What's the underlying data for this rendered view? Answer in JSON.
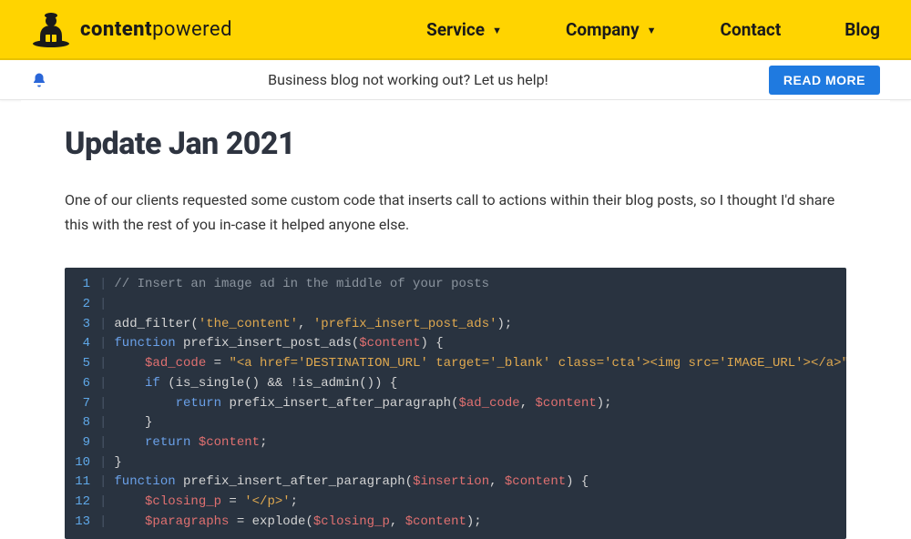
{
  "header": {
    "logo_bold": "content",
    "logo_light": "powered",
    "nav": [
      {
        "label": "Service",
        "dropdown": true
      },
      {
        "label": "Company",
        "dropdown": true
      },
      {
        "label": "Contact",
        "dropdown": false
      },
      {
        "label": "Blog",
        "dropdown": false
      }
    ]
  },
  "subbar": {
    "text": "Business blog not working out? Let us help!",
    "button": "READ MORE"
  },
  "article": {
    "title": "Update Jan 2021",
    "body": "One of our clients requested some custom code that inserts call to actions within their blog posts, so I thought I'd share this with the rest of you in-case it helped anyone else."
  },
  "code": {
    "lines": [
      {
        "n": 1,
        "t": [
          [
            "comment",
            "// Insert an image ad in the middle of your posts"
          ]
        ]
      },
      {
        "n": 2,
        "t": [
          [
            "plain",
            ""
          ]
        ]
      },
      {
        "n": 3,
        "t": [
          [
            "func",
            "add_filter("
          ],
          [
            "str",
            "'the_content'"
          ],
          [
            "func",
            ", "
          ],
          [
            "str",
            "'prefix_insert_post_ads'"
          ],
          [
            "func",
            ");"
          ]
        ]
      },
      {
        "n": 4,
        "t": [
          [
            "key",
            "function"
          ],
          [
            "func",
            " prefix_insert_post_ads("
          ],
          [
            "var",
            "$content"
          ],
          [
            "func",
            ") {"
          ]
        ]
      },
      {
        "n": 5,
        "t": [
          [
            "plain",
            "    "
          ],
          [
            "var",
            "$ad_code"
          ],
          [
            "func",
            " = "
          ],
          [
            "str",
            "\"<a href='DESTINATION_URL' target='_blank' class='cta'><img src='IMAGE_URL'></a>\""
          ],
          [
            "func",
            ";"
          ]
        ]
      },
      {
        "n": 6,
        "t": [
          [
            "plain",
            "    "
          ],
          [
            "key",
            "if"
          ],
          [
            "func",
            " (is_single() && !is_admin()) {"
          ]
        ]
      },
      {
        "n": 7,
        "t": [
          [
            "plain",
            "        "
          ],
          [
            "key",
            "return"
          ],
          [
            "func",
            " prefix_insert_after_paragraph("
          ],
          [
            "var",
            "$ad_code"
          ],
          [
            "func",
            ", "
          ],
          [
            "var",
            "$content"
          ],
          [
            "func",
            ");"
          ]
        ]
      },
      {
        "n": 8,
        "t": [
          [
            "plain",
            "    }"
          ]
        ]
      },
      {
        "n": 9,
        "t": [
          [
            "plain",
            "    "
          ],
          [
            "key",
            "return"
          ],
          [
            "func",
            " "
          ],
          [
            "var",
            "$content"
          ],
          [
            "func",
            ";"
          ]
        ]
      },
      {
        "n": 10,
        "t": [
          [
            "plain",
            "}"
          ]
        ]
      },
      {
        "n": 11,
        "t": [
          [
            "key",
            "function"
          ],
          [
            "func",
            " prefix_insert_after_paragraph("
          ],
          [
            "var",
            "$insertion"
          ],
          [
            "func",
            ", "
          ],
          [
            "var",
            "$content"
          ],
          [
            "func",
            ") {"
          ]
        ]
      },
      {
        "n": 12,
        "t": [
          [
            "plain",
            "    "
          ],
          [
            "var",
            "$closing_p"
          ],
          [
            "func",
            " = "
          ],
          [
            "str",
            "'</p>'"
          ],
          [
            "func",
            ";"
          ]
        ]
      },
      {
        "n": 13,
        "t": [
          [
            "plain",
            "    "
          ],
          [
            "var",
            "$paragraphs"
          ],
          [
            "func",
            " = explode("
          ],
          [
            "var",
            "$closing_p"
          ],
          [
            "func",
            ", "
          ],
          [
            "var",
            "$content"
          ],
          [
            "func",
            ");"
          ]
        ]
      }
    ]
  }
}
